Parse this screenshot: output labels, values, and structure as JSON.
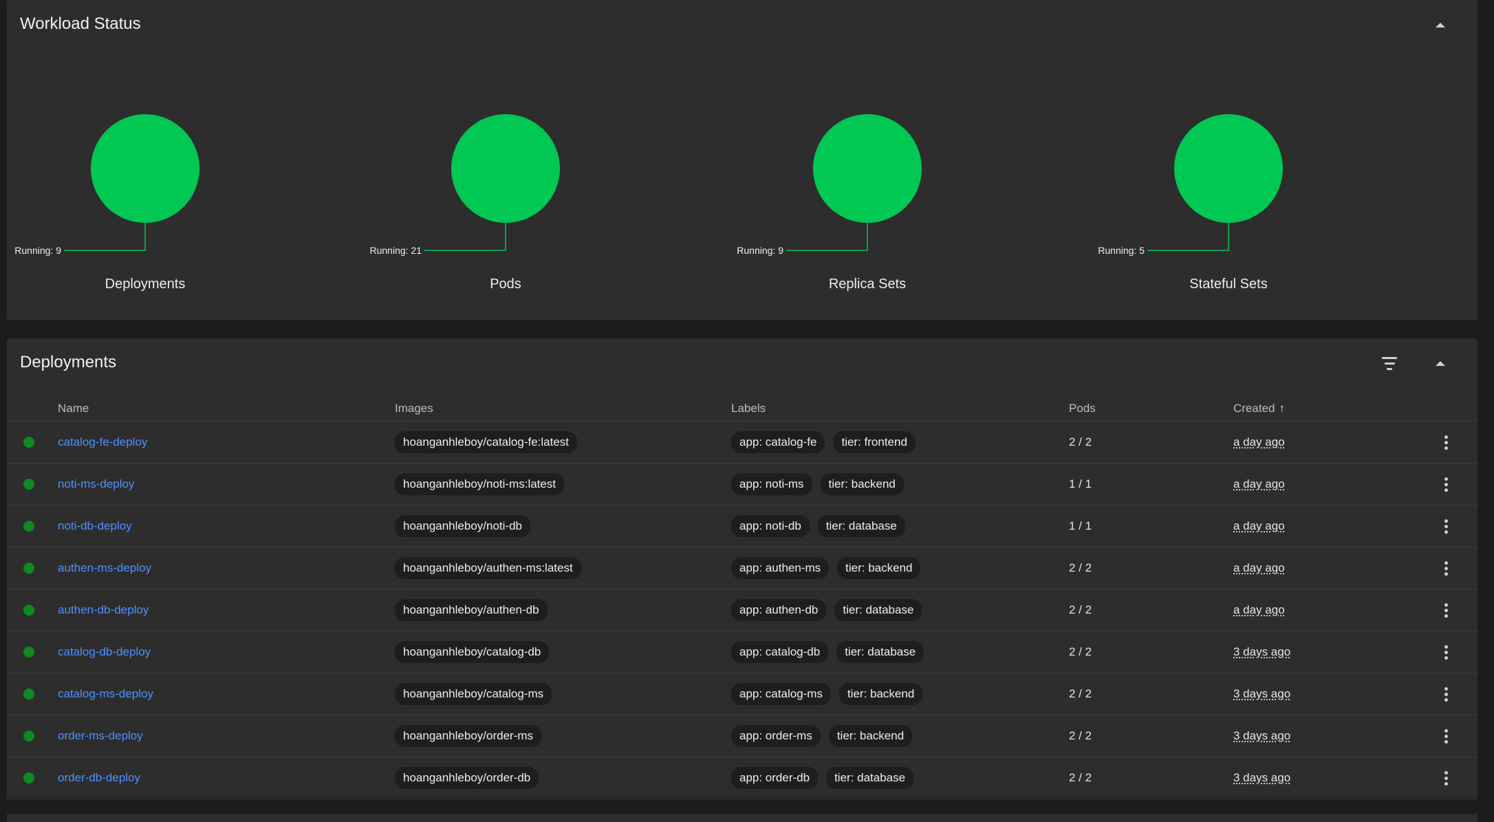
{
  "workload": {
    "title": "Workload Status",
    "accent_color": "#00c853",
    "charts": [
      {
        "name": "Deployments",
        "running_label": "Running: 9",
        "running": 9
      },
      {
        "name": "Pods",
        "running_label": "Running: 21",
        "running": 21
      },
      {
        "name": "Replica Sets",
        "running_label": "Running: 9",
        "running": 9
      },
      {
        "name": "Stateful Sets",
        "running_label": "Running: 5",
        "running": 5
      }
    ]
  },
  "deployments": {
    "title": "Deployments",
    "columns": {
      "name": "Name",
      "images": "Images",
      "labels": "Labels",
      "pods": "Pods",
      "created": "Created"
    },
    "sort_arrow": "↑",
    "rows": [
      {
        "name": "catalog-fe-deploy",
        "image": "hoanganhleboy/catalog-fe:latest",
        "labels": [
          "app: catalog-fe",
          "tier: frontend"
        ],
        "pods": "2 / 2",
        "created": "a day ago"
      },
      {
        "name": "noti-ms-deploy",
        "image": "hoanganhleboy/noti-ms:latest",
        "labels": [
          "app: noti-ms",
          "tier: backend"
        ],
        "pods": "1 / 1",
        "created": "a day ago"
      },
      {
        "name": "noti-db-deploy",
        "image": "hoanganhleboy/noti-db",
        "labels": [
          "app: noti-db",
          "tier: database"
        ],
        "pods": "1 / 1",
        "created": "a day ago"
      },
      {
        "name": "authen-ms-deploy",
        "image": "hoanganhleboy/authen-ms:latest",
        "labels": [
          "app: authen-ms",
          "tier: backend"
        ],
        "pods": "2 / 2",
        "created": "a day ago"
      },
      {
        "name": "authen-db-deploy",
        "image": "hoanganhleboy/authen-db",
        "labels": [
          "app: authen-db",
          "tier: database"
        ],
        "pods": "2 / 2",
        "created": "a day ago"
      },
      {
        "name": "catalog-db-deploy",
        "image": "hoanganhleboy/catalog-db",
        "labels": [
          "app: catalog-db",
          "tier: database"
        ],
        "pods": "2 / 2",
        "created": "3 days ago"
      },
      {
        "name": "catalog-ms-deploy",
        "image": "hoanganhleboy/catalog-ms",
        "labels": [
          "app: catalog-ms",
          "tier: backend"
        ],
        "pods": "2 / 2",
        "created": "3 days ago"
      },
      {
        "name": "order-ms-deploy",
        "image": "hoanganhleboy/order-ms",
        "labels": [
          "app: order-ms",
          "tier: backend"
        ],
        "pods": "2 / 2",
        "created": "3 days ago"
      },
      {
        "name": "order-db-deploy",
        "image": "hoanganhleboy/order-db",
        "labels": [
          "app: order-db",
          "tier: database"
        ],
        "pods": "2 / 2",
        "created": "3 days ago"
      }
    ]
  },
  "icons": {
    "collapse": "chevron-up-icon",
    "filter": "filter-icon",
    "more": "more-vert-icon",
    "status": "status-running-icon"
  }
}
